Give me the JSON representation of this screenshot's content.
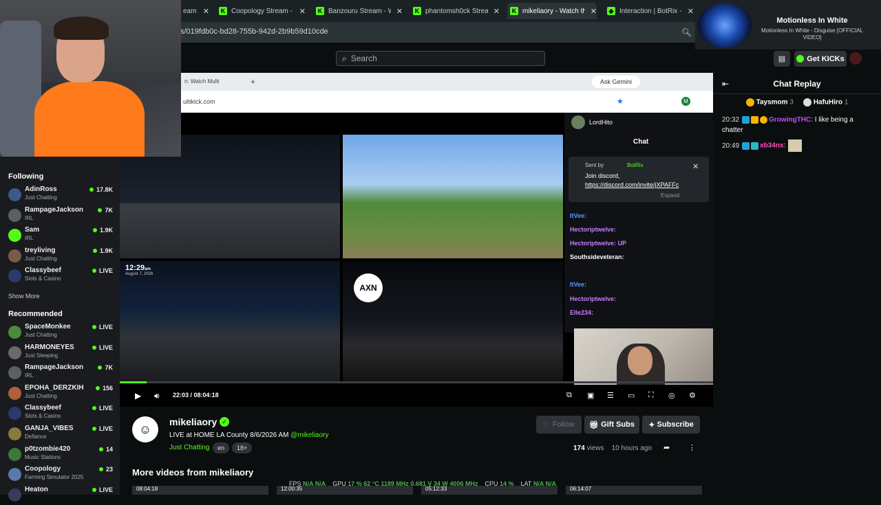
{
  "browser": {
    "tabs": [
      {
        "label": "eam",
        "active": false
      },
      {
        "label": "Coopology Stream - W",
        "active": false
      },
      {
        "label": "Banzouru Stream - W",
        "active": false
      },
      {
        "label": "phantomsh0ck Stream",
        "active": false
      },
      {
        "label": "mikeliaory - Watch th",
        "active": true
      },
      {
        "label": "Interaction | BotRix -",
        "active": false
      }
    ],
    "url": "s/019fdb0c-bd28-755b-942d-2b9b59d10cde"
  },
  "header": {
    "search_placeholder": "Search",
    "get_kicks_label": "Get KICKs"
  },
  "now_playing": {
    "title": "Motionless In White",
    "subtitle": "Motionless In White - Disguise [OFFICIAL VIDEO]"
  },
  "sidebar": {
    "following_heading": "Following",
    "following": [
      {
        "name": "AdinRoss",
        "category": "Just Chatting",
        "viewers": "17.8K",
        "color": "#3a5a8a"
      },
      {
        "name": "RampageJackson",
        "category": "IRL",
        "viewers": "7K",
        "color": "#5a5f66"
      },
      {
        "name": "Sam",
        "category": "IRL",
        "viewers": "1.9K",
        "color": "#53fc18"
      },
      {
        "name": "treyliving",
        "category": "Just Chatting",
        "viewers": "1.9K",
        "color": "#7a5a4a"
      },
      {
        "name": "Classybeef",
        "category": "Slots & Casino",
        "viewers": "LIVE",
        "color": "#2a3a6a"
      }
    ],
    "show_more": "Show More",
    "recommended_heading": "Recommended",
    "recommended": [
      {
        "name": "SpaceMonkee",
        "category": "Just Chatting",
        "viewers": "LIVE",
        "color": "#4a8a3a"
      },
      {
        "name": "HARMONEYES",
        "category": "Just Sleeping",
        "viewers": "LIVE",
        "color": "#6a6a6a"
      },
      {
        "name": "RampageJackson",
        "category": "IRL",
        "viewers": "7K",
        "color": "#5a5f66"
      },
      {
        "name": "EPOHA_DERZKIH",
        "category": "Just Chatting",
        "viewers": "156",
        "color": "#b0603a"
      },
      {
        "name": "Classybeef",
        "category": "Slots & Casino",
        "viewers": "LIVE",
        "color": "#2a3a6a"
      },
      {
        "name": "GANJA_VIBES",
        "category": "Defiance",
        "viewers": "LIVE",
        "color": "#8a7a3a"
      },
      {
        "name": "p0tzombie420",
        "category": "Music Stations",
        "viewers": "14",
        "color": "#3a7a3a"
      },
      {
        "name": "Coopology",
        "category": "Farming Simulator 2025",
        "viewers": "23",
        "color": "#5a7aaa"
      },
      {
        "name": "Heaton",
        "category": "",
        "viewers": "LIVE",
        "color": "#3a3a5a"
      }
    ]
  },
  "inner_browser": {
    "tab_label": "n: Watch Multi",
    "ask_gemini": "Ask Gemini",
    "url": "ultikick.com",
    "profile_letter": "M",
    "clock": "12:29",
    "clock_suffix": "am",
    "date": "August 7, 2026",
    "axn_logo": "AXN",
    "chat_user": "LordHito",
    "chat_title": "Chat",
    "pinned_sent_by": "Sent by",
    "pinned_bot": "BotRix",
    "pinned_message": "Join discord,",
    "pinned_link": "https://discord.com/invite/jXPAFFc",
    "pinned_expand": "Expand",
    "chat_lines": [
      {
        "text": "ItVee:",
        "color": "#5a9bff"
      },
      {
        "text": "Hectoriptwelve:",
        "color": "#c77dff"
      },
      {
        "text": "Hectoriptwelve: UP",
        "color": "#c77dff"
      },
      {
        "text": "Southsideveteran:",
        "color": "#ffffff"
      },
      {
        "text": "ItVee:",
        "color": "#5a9bff"
      },
      {
        "text": "Hectoriptwelve:",
        "color": "#c77dff"
      },
      {
        "text": "Elle234:",
        "color": "#c77dff"
      }
    ]
  },
  "player": {
    "current_time": "22:03",
    "duration": "08:04:18",
    "progress_fraction": 0.045
  },
  "channel": {
    "name": "mikeliaory",
    "stream_title": "LIVE at HOME LA County 8/6/2026 AM",
    "handle": "@mikeliaory",
    "category": "Just Chatting",
    "tags": [
      "en",
      "18+"
    ],
    "follow_label": "Follow",
    "gift_subs_label": "Gift Subs",
    "subscribe_label": "Subscribe",
    "views_count": "174",
    "views_label": "views",
    "time_ago": "10 hours ago"
  },
  "more_videos": {
    "heading": "More videos from mikeliaory",
    "durations": [
      "08:04:18",
      "12:00:35",
      "05:12:33",
      "06:14:07"
    ]
  },
  "perf": {
    "fps_label": "FPS",
    "fps": "N/A  N/A",
    "gpu_label": "GPU",
    "gpu": "17 %  62 °C  1189 MHz  0.681 V  34 W  4006 MHz",
    "cpu_label": "CPU",
    "cpu": "14 %",
    "lat_label": "LAT",
    "lat": "N/A  N/A"
  },
  "chat": {
    "title": "Chat Replay",
    "leaders": [
      {
        "name": "Taysmom",
        "count": "3"
      },
      {
        "name": "HafuHiro",
        "count": "1"
      }
    ],
    "messages": [
      {
        "time": "20:32",
        "user": "GrowingTHC",
        "text": "I like being a chatter"
      },
      {
        "time": "20:49",
        "user": "xb34nx",
        "text": ""
      }
    ]
  }
}
